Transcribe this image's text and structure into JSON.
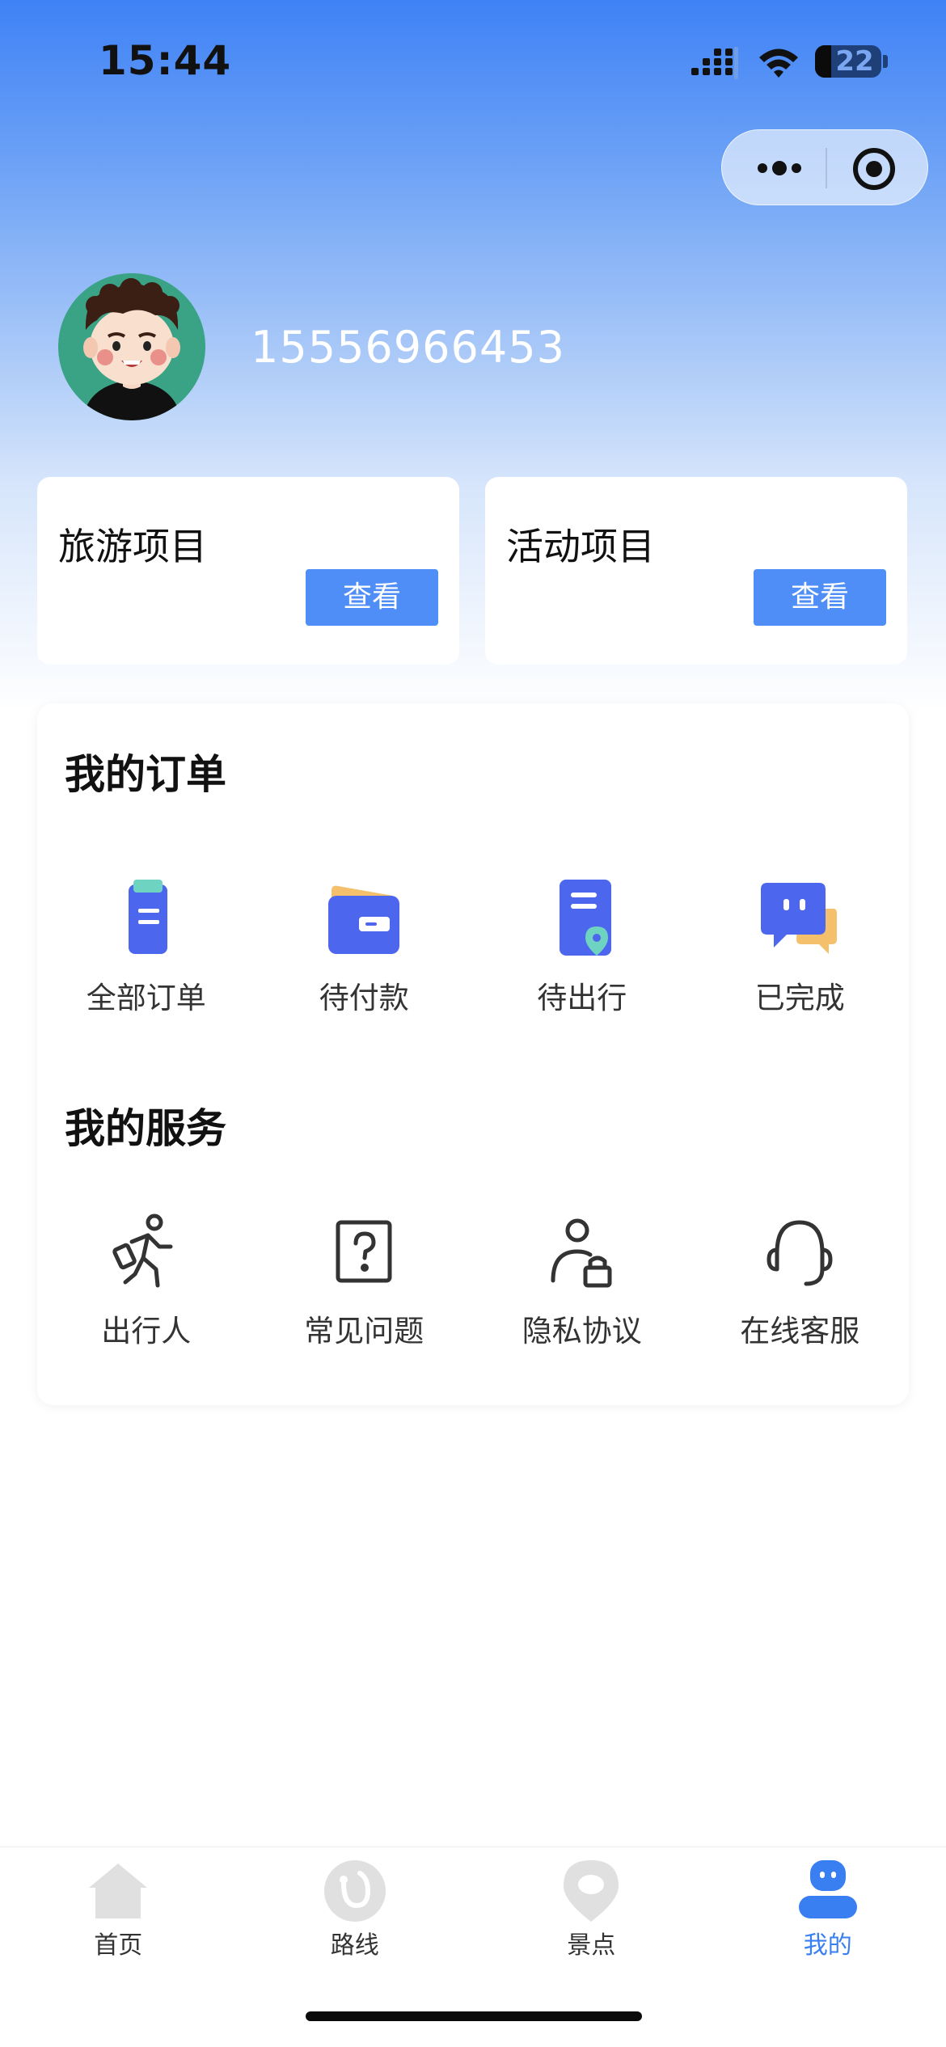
{
  "status_bar": {
    "time": "15:44",
    "battery": "22"
  },
  "profile": {
    "phone": "15556966453"
  },
  "projects": [
    {
      "title": "旅游项目",
      "button": "查看"
    },
    {
      "title": "活动项目",
      "button": "查看"
    }
  ],
  "orders": {
    "title": "我的订单",
    "items": [
      {
        "label": "全部订单",
        "icon": "clipboard-icon"
      },
      {
        "label": "待付款",
        "icon": "wallet-icon"
      },
      {
        "label": "待出行",
        "icon": "location-document-icon"
      },
      {
        "label": "已完成",
        "icon": "chat-bubble-icon"
      }
    ]
  },
  "services": {
    "title": "我的服务",
    "items": [
      {
        "label": "出行人",
        "icon": "traveler-icon"
      },
      {
        "label": "常见问题",
        "icon": "question-icon"
      },
      {
        "label": "隐私协议",
        "icon": "user-lock-icon"
      },
      {
        "label": "在线客服",
        "icon": "headset-icon"
      }
    ]
  },
  "tabbar": [
    {
      "label": "首页",
      "icon": "home-icon",
      "active": false
    },
    {
      "label": "路线",
      "icon": "route-icon",
      "active": false
    },
    {
      "label": "景点",
      "icon": "location-pin-icon",
      "active": false
    },
    {
      "label": "我的",
      "icon": "profile-icon",
      "active": true
    }
  ],
  "colors": {
    "accent": "#4f8ef7",
    "tab_active": "#3a7ff1",
    "hero_top": "#3f82f6"
  }
}
